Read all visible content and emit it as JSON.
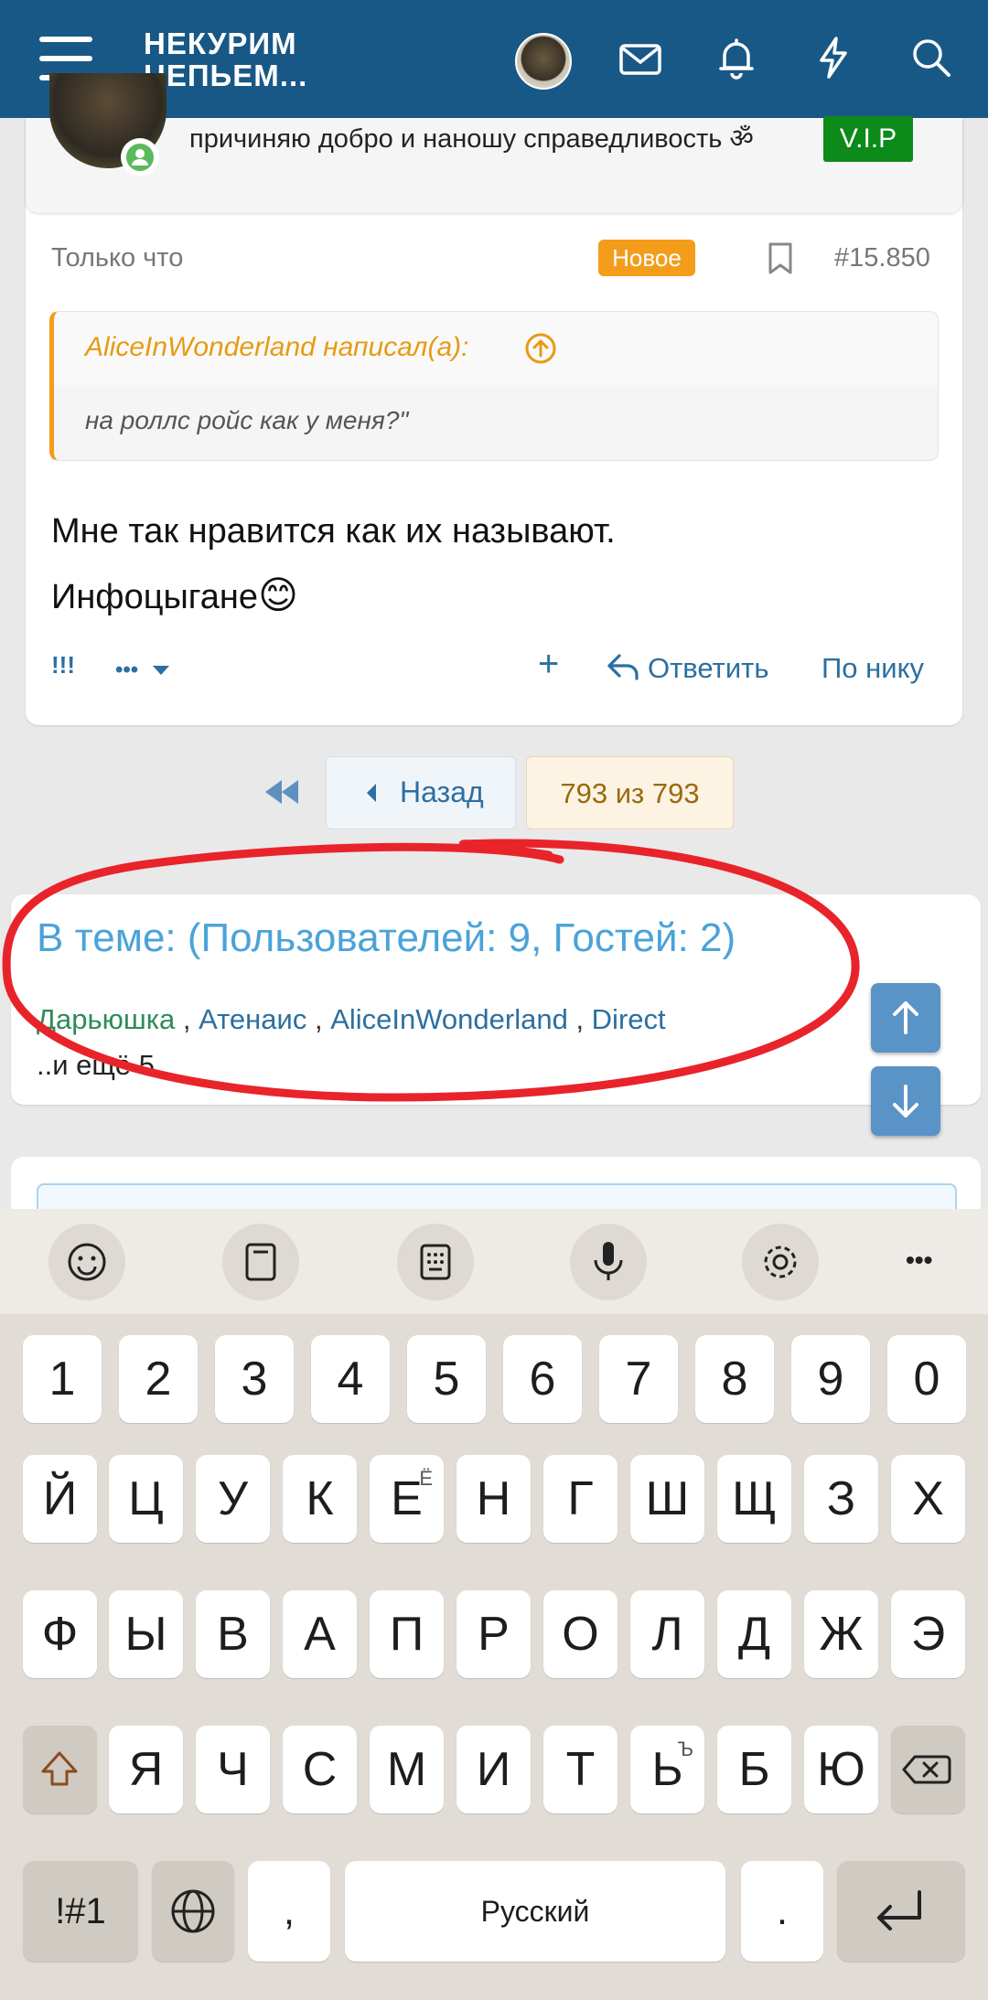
{
  "header": {
    "logo_line1": "НЕКУРИМ",
    "logo_line2": "НЕПЬЕМ...",
    "icons": [
      "menu-icon",
      "avatar",
      "mail-icon",
      "bell-icon",
      "lightning-icon",
      "search-icon"
    ]
  },
  "post": {
    "user_status": "причиняю добро и наношу справедливость ॐ",
    "user_badge": "V.I.P",
    "time": "Только что",
    "new_badge": "Новое",
    "post_number": "#15.850",
    "quote": {
      "author": "AliceInWonderland написал(а):",
      "text": "на роллс ройс как у меня?\""
    },
    "body_line1": "Мне так нравится как их называют.",
    "body_line2": "Инфоцыгане",
    "body_emoji": "😊",
    "actions": {
      "react": "!!!",
      "more": "•••",
      "add": "+",
      "reply": "Ответить",
      "by_nick": "По нику"
    }
  },
  "pagination": {
    "first": "◀◀",
    "back": "Назад",
    "current": "793 из 793"
  },
  "who_here": {
    "title": "В теме: (Пользователей: 9, Гостей: 2)",
    "users": [
      {
        "name": "Дарьюшка",
        "color": "#2e8b57"
      },
      {
        "name": "Атенаис",
        "color": "#2c6fa0"
      },
      {
        "name": "AliceInWonderland",
        "color": "#2c6fa0"
      },
      {
        "name": "Direct",
        "color": "#2c6fa0"
      }
    ],
    "separator": " , ",
    "more": "..и ещё 5."
  },
  "keyboard": {
    "toolbar": [
      "emoji-icon",
      "clipboard-icon",
      "keypad-icon",
      "microphone-icon",
      "settings-icon",
      "more-icon"
    ],
    "toolbar_more": "•••",
    "row_numbers": [
      "1",
      "2",
      "3",
      "4",
      "5",
      "6",
      "7",
      "8",
      "9",
      "0"
    ],
    "row1": [
      "Й",
      "Ц",
      "У",
      "К",
      "Е",
      "Н",
      "Г",
      "Ш",
      "Щ",
      "З",
      "Х"
    ],
    "row1_sup": {
      "Е": "Ё"
    },
    "row2": [
      "Ф",
      "Ы",
      "В",
      "А",
      "П",
      "Р",
      "О",
      "Л",
      "Д",
      "Ж",
      "Э"
    ],
    "row3": [
      "Я",
      "Ч",
      "С",
      "М",
      "И",
      "Т",
      "Ь",
      "Б",
      "Ю"
    ],
    "row3_sup": {
      "Ь": "Ъ"
    },
    "symbols": "!#1",
    "comma": ",",
    "space": "Русский",
    "period": ".",
    "colors": {
      "accent": "#185886",
      "link": "#2c6fa0",
      "orange": "#f39d1b",
      "vip": "#0c8a1a"
    }
  }
}
